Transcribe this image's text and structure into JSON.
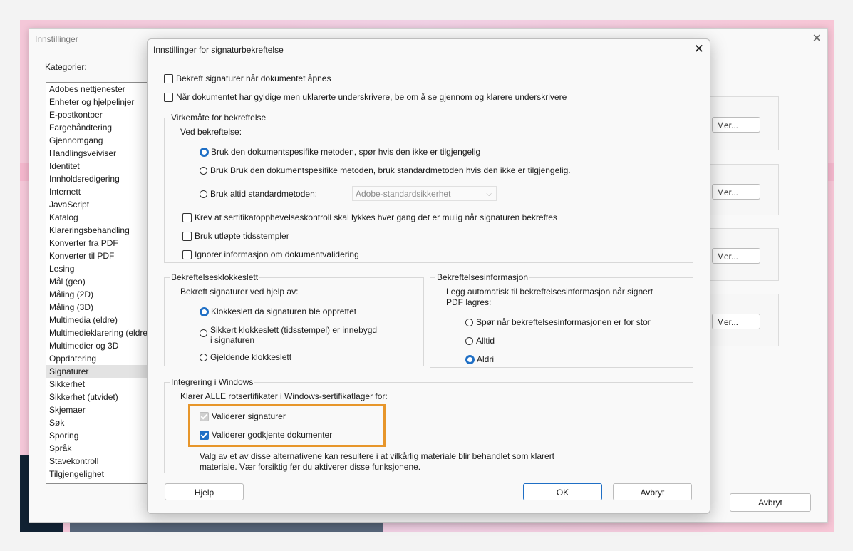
{
  "main_window": {
    "title": "Innstillinger",
    "categories_label": "Kategorier:",
    "categories": [
      "Adobes nettjenester",
      "Enheter og hjelpelinjer",
      "E-postkontoer",
      "Fargehåndtering",
      "Gjennomgang",
      "Handlingsveiviser",
      "Identitet",
      "Innholdsredigering",
      "Internett",
      "JavaScript",
      "Katalog",
      "Klareringsbehandling",
      "Konverter fra PDF",
      "Konverter til PDF",
      "Lesing",
      "Mål (geo)",
      "Måling (2D)",
      "Måling (3D)",
      "Multimedia (eldre)",
      "Multimedieklarering (eldre)",
      "Multimedier og 3D",
      "Oppdatering",
      "Signaturer",
      "Sikkerhet",
      "Sikkerhet (utvidet)",
      "Skjemaer",
      "Søk",
      "Sporing",
      "Språk",
      "Stavekontroll",
      "Tilgjengelighet"
    ],
    "selected_category": "Signaturer",
    "mer_buttons": [
      "Mer...",
      "Mer...",
      "Mer...",
      "Mer..."
    ],
    "cancel_label": "Avbryt"
  },
  "dialog": {
    "title": "Innstillinger for signaturbekreftelse",
    "top_checks": [
      {
        "label": "Bekreft signaturer når dokumentet åpnes",
        "checked": false
      },
      {
        "label": "Når dokumentet har gyldige men uklarerte underskrivere, be om å se gjennom og klarere underskrivere",
        "checked": false
      }
    ],
    "behavior": {
      "legend": "Virkemåte for bekreftelse",
      "subtitle": "Ved bekreftelse:",
      "radios": [
        {
          "label": "Bruk den dokumentspesifike metoden, spør hvis den ikke er tilgjengelig",
          "selected": true
        },
        {
          "label": "Bruk Bruk den dokumentspesifike metoden, bruk standardmetoden hvis den ikke er tilgjengelig.",
          "selected": false
        },
        {
          "label": "Bruk altid standardmetoden:",
          "selected": false
        }
      ],
      "default_method": "Adobe-standardsikkerhet",
      "checks": [
        {
          "label": "Krev at sertifikatopphevelseskontroll skal lykkes hver gang det er mulig når signaturen bekreftes",
          "checked": false
        },
        {
          "label": "Bruk utløpte tidsstempler",
          "checked": false
        },
        {
          "label": "Ignorer informasjon om dokumentvalidering",
          "checked": false
        }
      ]
    },
    "time": {
      "legend": "Bekreftelsesklokkeslett",
      "subtitle": "Bekreft signaturer ved hjelp av:",
      "radios": [
        {
          "label": "Klokkeslett da signaturen ble opprettet",
          "selected": true
        },
        {
          "label": "Sikkert klokkeslett (tidsstempel) er innebygd",
          "label2": "i signaturen",
          "selected": false
        },
        {
          "label": "Gjeldende klokkeslett",
          "selected": false
        }
      ]
    },
    "info": {
      "legend": "Bekreftelsesinformasjon",
      "subtitle": "Legg automatisk til bekreftelsesinformasjon når signert",
      "subtitle2": "PDF lagres:",
      "radios": [
        {
          "label": "Spør når bekreftelsesinformasjonen er for stor",
          "selected": false
        },
        {
          "label": "Alltid",
          "selected": false
        },
        {
          "label": "Aldri",
          "selected": true
        }
      ]
    },
    "windows": {
      "legend": "Integrering i Windows",
      "subtitle": "Klarer ALLE rotsertifikater i Windows-sertifikatlager for:",
      "checks": [
        {
          "label": "Validerer signaturer",
          "checked": true,
          "disabled": true
        },
        {
          "label": "Validerer godkjente dokumenter",
          "checked": true,
          "disabled": false
        }
      ],
      "note1": "Valg av et av disse alternativene kan resultere i at vilkårlig materiale blir behandlet som klarert",
      "note2": "materiale. Vær forsiktig før du aktiverer disse funksjonene."
    },
    "buttons": {
      "help": "Hjelp",
      "ok": "OK",
      "cancel": "Avbryt"
    }
  },
  "colors": {
    "accent": "#1f6fc5",
    "highlight": "#e7962b"
  }
}
